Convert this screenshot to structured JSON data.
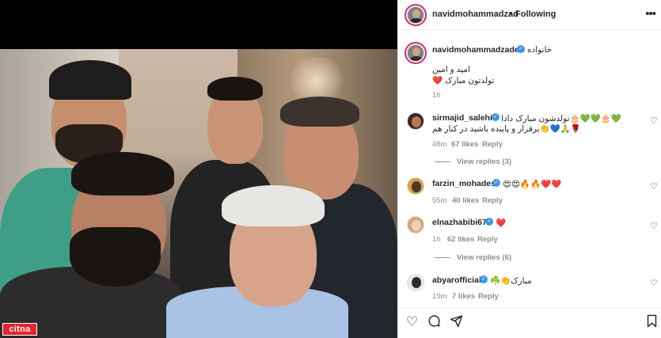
{
  "watermark": {
    "text": "citna"
  },
  "post": {
    "header": {
      "username": "navidmohammadzad",
      "dot": "•",
      "follow_status": "Following",
      "more_icon": "more-options-icon"
    },
    "caption": {
      "username": "navidmohammadzadeh",
      "line1": "خانواده",
      "line2": "امید و امین",
      "line3": "تولدتون مبارک ❤️",
      "time": "1h"
    },
    "comments": [
      {
        "username": "sirmajid_salehi",
        "text_line1": "💚🎂💚💚🎂تولدشون مبارک دادا",
        "text_line2": "🌹🙏💙👏برقرار و پاینده باشید در کنار هم",
        "time": "48m",
        "likes": "67 likes",
        "reply": "Reply",
        "view_replies": "View replies (3)"
      },
      {
        "username": "farzin_mohades",
        "text_line1": "😍😍🔥🔥❤️❤️",
        "time": "55m",
        "likes": "40 likes",
        "reply": "Reply"
      },
      {
        "username": "elnazhabibi67",
        "text_line1": "❤️",
        "time": "1h",
        "likes": "62 likes",
        "reply": "Reply",
        "view_replies": "View replies (6)"
      },
      {
        "username": "abyarofficial",
        "text_line1": "مبارک👏☘️",
        "time": "19m",
        "likes": "7 likes",
        "reply": "Reply"
      }
    ],
    "actions": {
      "like_icon": "heart-icon",
      "comment_icon": "comment-icon",
      "share_icon": "share-icon",
      "save_icon": "bookmark-icon"
    }
  },
  "colors": {
    "verified": "#3897f0",
    "story_ring": "#d62976",
    "muted_text": "#8e8e8e",
    "watermark": "#e4242a"
  }
}
